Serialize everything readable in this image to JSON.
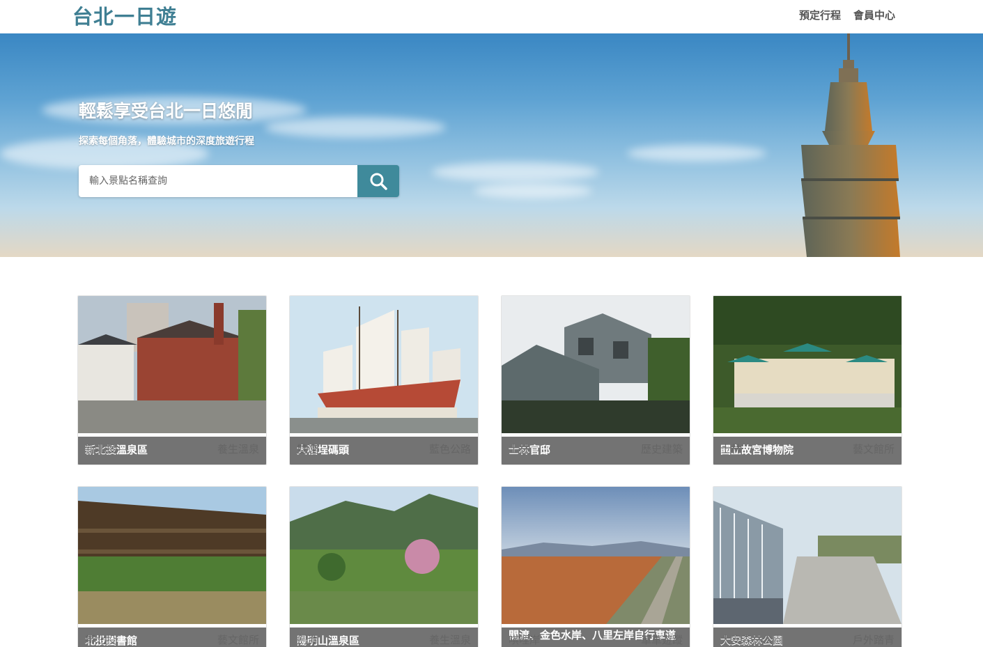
{
  "header": {
    "brand": "台北一日遊",
    "nav": [
      "預定行程",
      "會員中心"
    ]
  },
  "hero": {
    "title": "輕鬆享受台北一日悠閒",
    "subtitle": "探索每個角落，體驗城市的深度旅遊行程",
    "search_placeholder": "輸入景點名稱查詢",
    "search_icon": "search-icon"
  },
  "colors": {
    "brand": "#3f7f93",
    "search_button": "#3f8a9b"
  },
  "attractions": [
    {
      "name": "新北投溫泉區",
      "area": "新北投",
      "category": "養生溫泉"
    },
    {
      "name": "大稻埕碼頭",
      "area": "雙連",
      "category": "藍色公路"
    },
    {
      "name": "士林官邸",
      "area": "士林",
      "category": "歷史建築"
    },
    {
      "name": "國立故宮博物院",
      "area": "士林",
      "category": "藝文館所"
    },
    {
      "name": "北投圖書館",
      "area": "新北投",
      "category": "藝文館所"
    },
    {
      "name": "陽明山溫泉區",
      "area": "劍潭",
      "category": "養生溫泉"
    },
    {
      "name": "關渡、金色水岸、八里左岸自行車道",
      "area": "唭哩岸",
      "category": "單車遊蹤"
    },
    {
      "name": "大安森林公園",
      "area": "大安森林公園",
      "category": "戶外踏青"
    }
  ]
}
